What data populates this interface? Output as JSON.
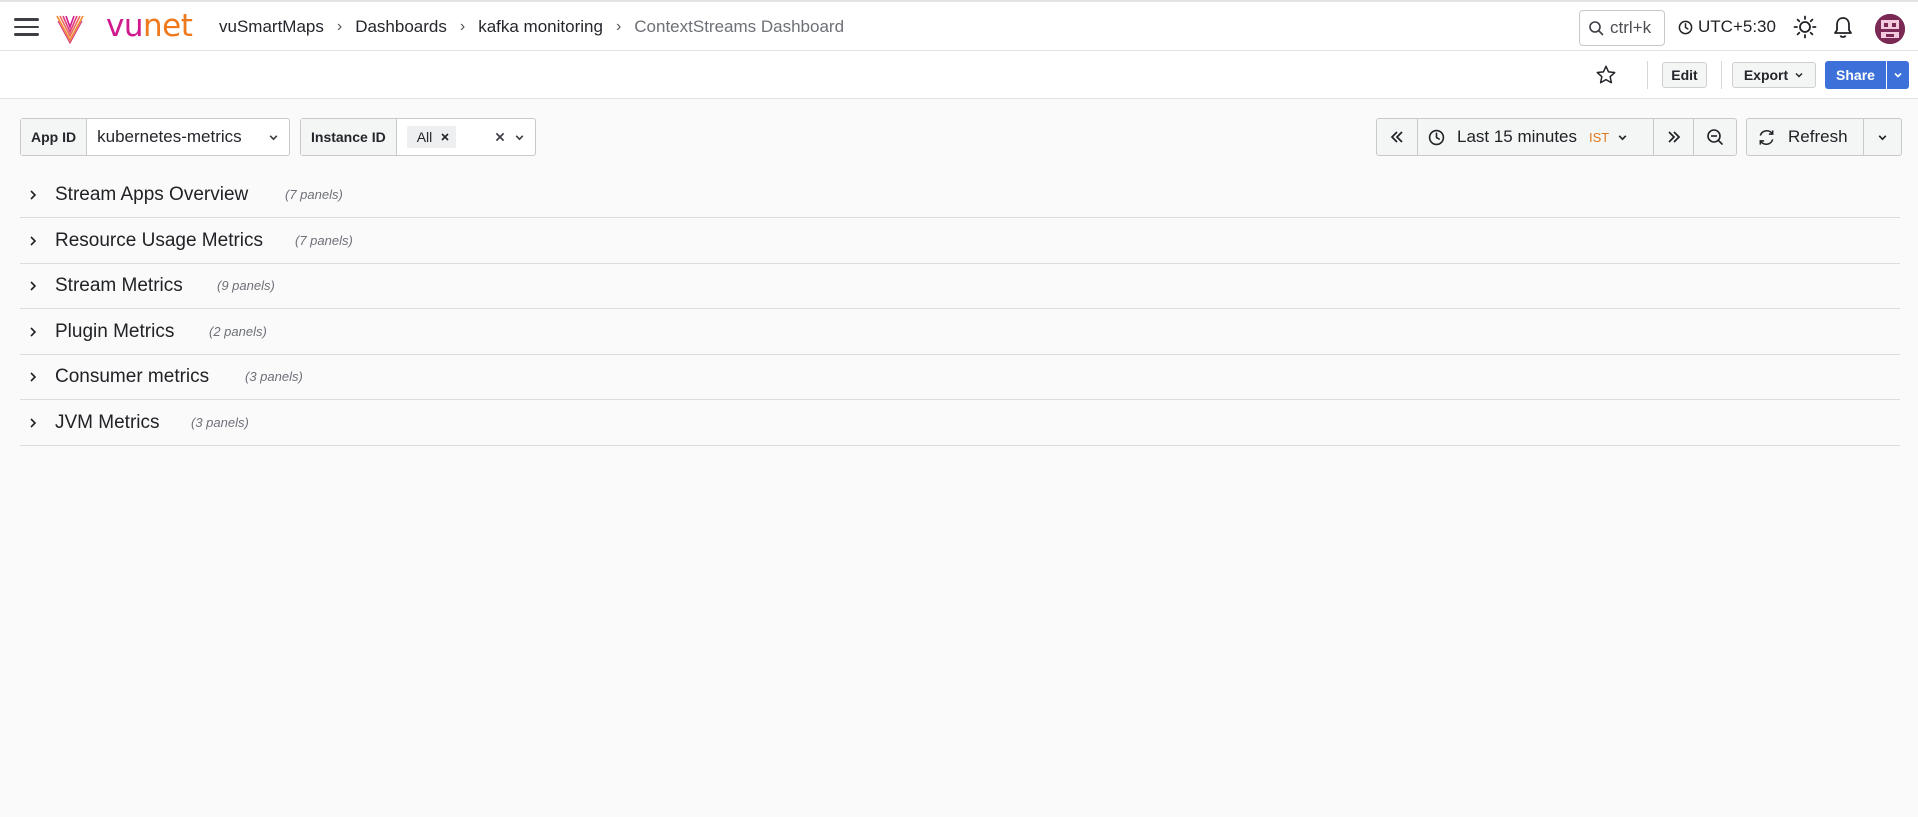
{
  "app": {
    "logo_text_part1": "vu",
    "logo_text_part2": "net"
  },
  "breadcrumb": [
    {
      "label": "vuSmartMaps"
    },
    {
      "label": "Dashboards"
    },
    {
      "label": "kafka monitoring"
    },
    {
      "label": "ContextStreams Dashboard"
    }
  ],
  "topbar": {
    "search_shortcut": "ctrl+k",
    "timezone": "UTC+5:30"
  },
  "toolbar": {
    "edit_label": "Edit",
    "export_label": "Export",
    "share_label": "Share"
  },
  "variables": {
    "app_id": {
      "label": "App ID",
      "value": "kubernetes-metrics"
    },
    "instance_id": {
      "label": "Instance ID",
      "value": "All"
    }
  },
  "time_picker": {
    "range": "Last 15 minutes",
    "timezone_badge": "IST",
    "refresh_label": "Refresh"
  },
  "rows": [
    {
      "title": "Stream Apps Overview",
      "count": "(7 panels)"
    },
    {
      "title": "Resource Usage Metrics",
      "count": "(7 panels)"
    },
    {
      "title": "Stream Metrics",
      "count": "(9 panels)"
    },
    {
      "title": "Plugin Metrics",
      "count": "(2 panels)"
    },
    {
      "title": "Consumer metrics",
      "count": "(3 panels)"
    },
    {
      "title": "JVM Metrics",
      "count": "(3 panels)"
    }
  ],
  "colors": {
    "brand_pink": "#d0198d",
    "brand_orange": "#ef7a1e",
    "primary_blue": "#3d71d9"
  }
}
